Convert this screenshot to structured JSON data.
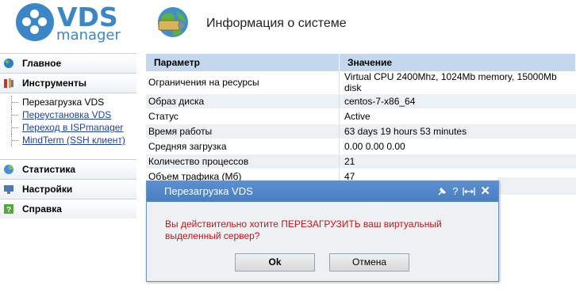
{
  "logo": {
    "word1": "VDS",
    "word2": "manager",
    "color": "#3b86c6"
  },
  "header": {
    "title": "Информация о системе"
  },
  "sidebar": {
    "items": [
      {
        "label": "Главное"
      },
      {
        "label": "Инструменты"
      },
      {
        "label": "Статистика"
      },
      {
        "label": "Настройки"
      },
      {
        "label": "Справка"
      }
    ],
    "submenu": [
      {
        "label": "Перезагрузка VDS"
      },
      {
        "label": "Переустановка VDS"
      },
      {
        "label": "Переход в ISPmanager"
      },
      {
        "label": "MindTerm (SSH клиент)"
      }
    ]
  },
  "table": {
    "headers": [
      "Параметр",
      "Значение"
    ],
    "rows": [
      {
        "param": "Ограничения на ресурсы",
        "value": "Virtual CPU 2400Mhz, 1024Mb memory, 15000Mb disk"
      },
      {
        "param": "Образ диска",
        "value": "centos-7-x86_64"
      },
      {
        "param": "Статус",
        "value": "Active"
      },
      {
        "param": "Время работы",
        "value": "63 days 19 hours 53 minutes"
      },
      {
        "param": "Средняя загрузка",
        "value": "0.00 0.00 0.00"
      },
      {
        "param": "Количество процессов",
        "value": "21"
      },
      {
        "param": "Объем трафика (Мб)",
        "value": "47"
      }
    ]
  },
  "dialog": {
    "title": "Перезагрузка VDS",
    "message": "Вы действительно хотите ПЕРЕЗАГРУЗИТЬ ваш виртуальный выделенный сервер?",
    "ok_label": "Ok",
    "cancel_label": "Отмена",
    "tools": {
      "help": "?",
      "close": "✕"
    }
  }
}
